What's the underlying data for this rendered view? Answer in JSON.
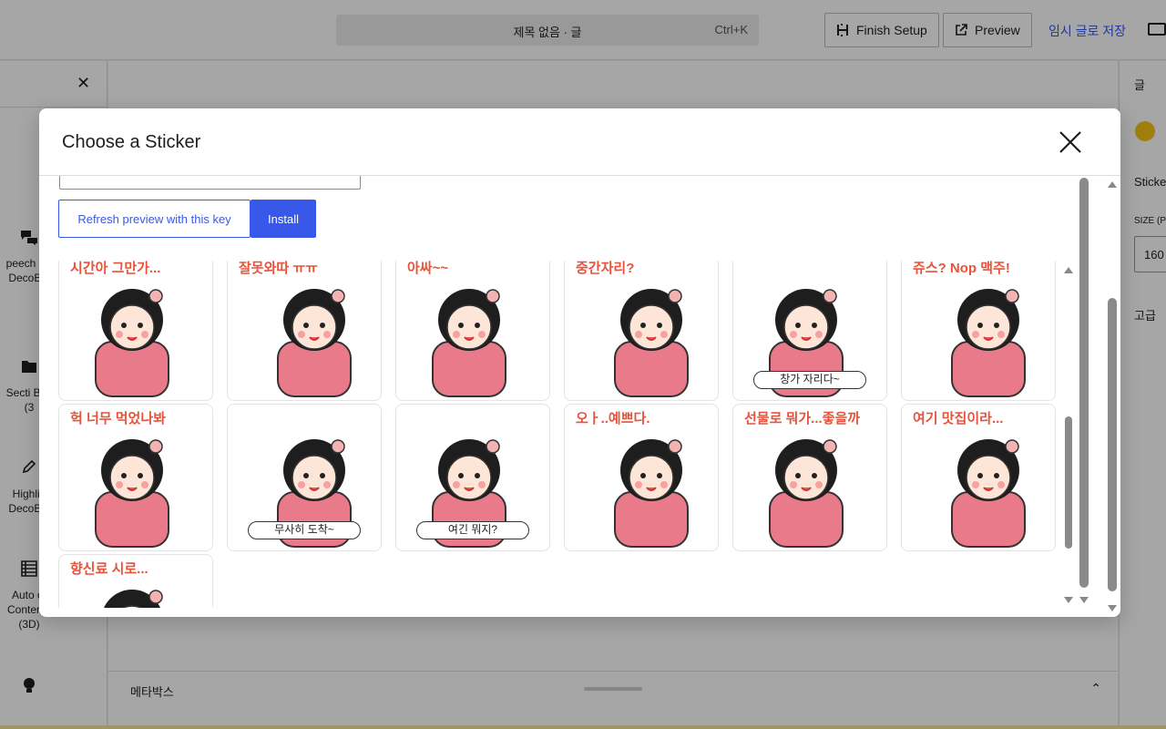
{
  "topbar": {
    "command_title": "제목 없음 · 글",
    "command_shortcut": "Ctrl+K",
    "finish_setup": "Finish Setup",
    "preview": "Preview",
    "save_draft": "임시 글로 저장"
  },
  "left_panel": {
    "items": [
      {
        "label": "peech Bu DecoBlo",
        "icon": "speech-bubbles-icon"
      },
      {
        "label": "Secti Box (3",
        "icon": "folder-icon"
      },
      {
        "label": "Highlig DecoBlo",
        "icon": "pencil-icon"
      },
      {
        "label": "Auto of Contents (3D)",
        "icon": "table-icon"
      },
      {
        "label": "",
        "icon": "lightbulb-icon"
      }
    ]
  },
  "right_panel": {
    "tab": "글",
    "sticker_label": "Sticke",
    "size_label": "SIZE (P",
    "size_value": "160",
    "advanced": "고급"
  },
  "metabox": {
    "label": "메타박스"
  },
  "modal": {
    "title": "Choose a Sticker",
    "refresh_button": "Refresh preview with this key",
    "install_button": "Install"
  },
  "stickers": [
    {
      "caption": "시간아 그만가...",
      "bubble": ""
    },
    {
      "caption": "잘못와따 ㅠㅠ",
      "bubble": ""
    },
    {
      "caption": "아싸~~",
      "bubble": ""
    },
    {
      "caption": "중간자리?",
      "bubble": ""
    },
    {
      "caption": "",
      "bubble": "창가 자리다~"
    },
    {
      "caption": "쥬스? Nop 맥주!",
      "bubble": ""
    },
    {
      "caption": "헉 너무 먹었나봐",
      "bubble": ""
    },
    {
      "caption": "",
      "bubble": "무사히 도착~"
    },
    {
      "caption": "",
      "bubble": "여긴 뭐지?"
    },
    {
      "caption": "오ㅏ..예쁘다.",
      "bubble": ""
    },
    {
      "caption": "선물로 뭐가...좋을까",
      "bubble": ""
    },
    {
      "caption": "여기 맛집이라...",
      "bubble": ""
    },
    {
      "caption": "향신료 시로...",
      "bubble": ""
    }
  ],
  "colors": {
    "accent": "#3858e9",
    "sticker_text": "#e8533b",
    "kimono": "#e97a8a",
    "hair": "#1e1e1e"
  }
}
